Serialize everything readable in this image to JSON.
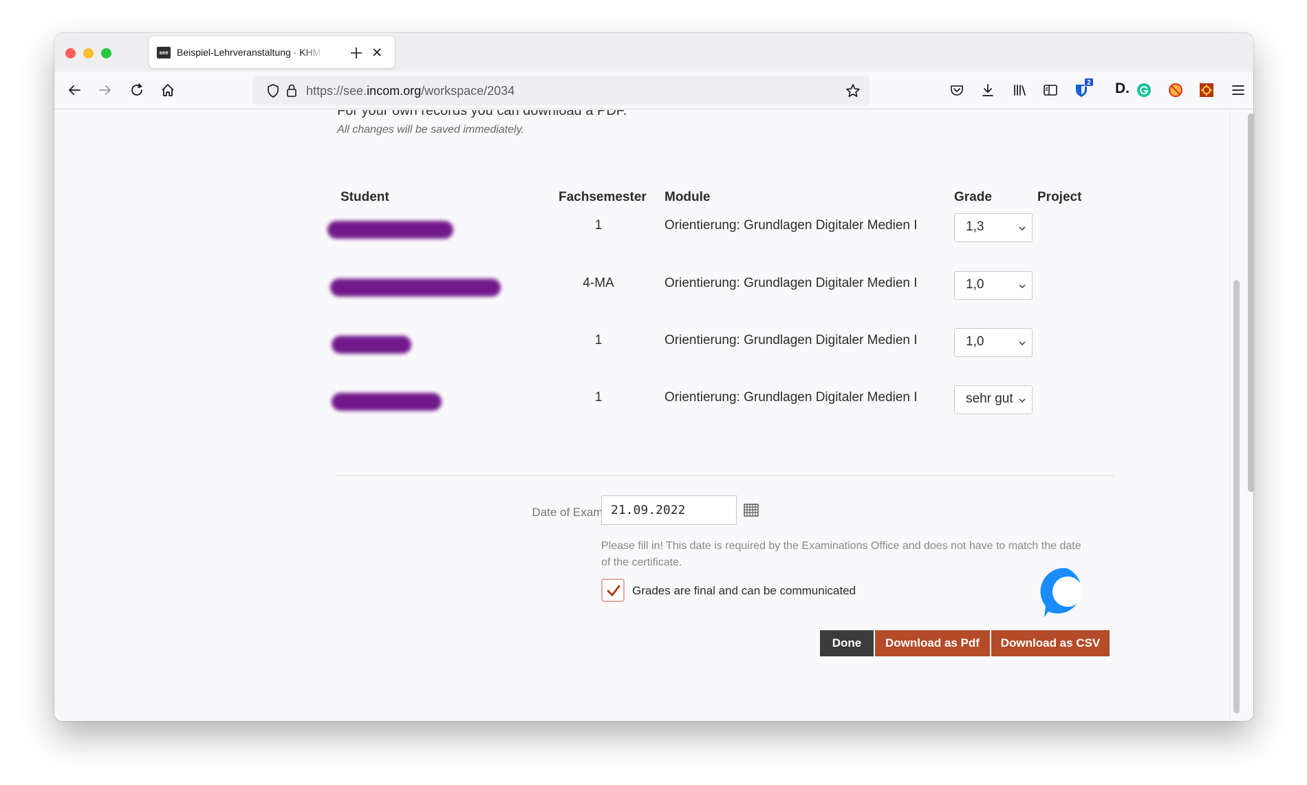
{
  "browser": {
    "tab": {
      "favicon": "see",
      "title": "Beispiel-Lehrveranstaltung · KHM"
    },
    "url": {
      "prefix": "https://see.",
      "host": "incom.org",
      "path": "/workspace/2034"
    },
    "badge_count": "2",
    "toolbar_icons": [
      "pocket-icon",
      "download-icon",
      "library-icon",
      "reader-view-icon",
      "bitwarden-icon",
      "dd-logo-icon",
      "grammarly-icon",
      "ad-block-icon",
      "extension-icon",
      "menu-icon"
    ],
    "extension_logo": "D."
  },
  "page": {
    "cut_text": "For your own records you can download a PDF.",
    "note": "All changes will be saved immediately.",
    "table": {
      "headers": {
        "student": "Student",
        "semester": "Fachsemester",
        "module": "Module",
        "grade": "Grade",
        "project": "Project"
      },
      "rows": [
        {
          "semester": "1",
          "module": "Orientierung: Grundlagen Digitaler Medien I",
          "grade": "1,3"
        },
        {
          "semester": "4-MA",
          "module": "Orientierung: Grundlagen Digitaler Medien I",
          "grade": "1,0"
        },
        {
          "semester": "1",
          "module": "Orientierung: Grundlagen Digitaler Medien I",
          "grade": "1,0"
        },
        {
          "semester": "1",
          "module": "Orientierung: Grundlagen Digitaler Medien I",
          "grade": "sehr gut"
        }
      ]
    },
    "exam": {
      "label": "Date of Exam*",
      "value": "21.09.2022",
      "help": "Please fill in! This date is required by the Examinations Office and does not have to match the date of the certificate."
    },
    "final_checkbox": {
      "label": "Grades are final and can be communicated",
      "checked": true
    },
    "buttons": {
      "done": "Done",
      "pdf": "Download as Pdf",
      "csv": "Download as CSV"
    }
  },
  "colors": {
    "accent": "#b54b29",
    "dark_button": "#3b3b3b",
    "redaction": "#6b0f86",
    "chat": "#1a8cff"
  }
}
